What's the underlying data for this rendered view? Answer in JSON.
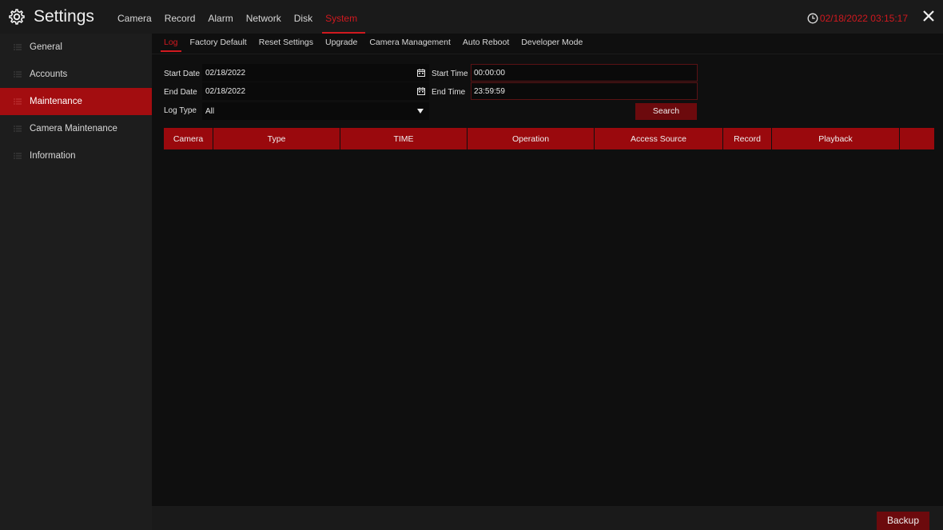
{
  "app": {
    "title": "Settings",
    "icon": "gear-icon"
  },
  "topnav": {
    "items": [
      {
        "label": "Camera",
        "active": false
      },
      {
        "label": "Record",
        "active": false
      },
      {
        "label": "Alarm",
        "active": false
      },
      {
        "label": "Network",
        "active": false
      },
      {
        "label": "Disk",
        "active": false
      },
      {
        "label": "System",
        "active": true
      }
    ]
  },
  "clock": {
    "datetime": "02/18/2022 03:15:17",
    "icon": "clock-icon"
  },
  "close": {
    "icon": "close-icon"
  },
  "sidebar": {
    "items": [
      {
        "label": "General",
        "active": false
      },
      {
        "label": "Accounts",
        "active": false
      },
      {
        "label": "Maintenance",
        "active": true
      },
      {
        "label": "Camera Maintenance",
        "active": false
      },
      {
        "label": "Information",
        "active": false
      }
    ]
  },
  "subnav": {
    "tabs": [
      {
        "label": "Log",
        "active": true
      },
      {
        "label": "Factory Default",
        "active": false
      },
      {
        "label": "Reset Settings",
        "active": false
      },
      {
        "label": "Upgrade",
        "active": false
      },
      {
        "label": "Camera Management",
        "active": false
      },
      {
        "label": "Auto Reboot",
        "active": false
      },
      {
        "label": "Developer Mode",
        "active": false
      }
    ]
  },
  "form": {
    "start_date_label": "Start Date",
    "start_date_value": "02/18/2022",
    "start_time_label": "Start Time",
    "start_time_value": "00:00:00",
    "end_date_label": "End Date",
    "end_date_value": "02/18/2022",
    "end_time_label": "End Time",
    "end_time_value": "23:59:59",
    "log_type_label": "Log Type",
    "log_type_value": "All",
    "search_label": "Search"
  },
  "table": {
    "columns": [
      "Camera",
      "Type",
      "TIME",
      "Operation",
      "Access Source",
      "Record",
      "Playback",
      ""
    ]
  },
  "footer": {
    "backup_label": "Backup"
  },
  "colors": {
    "accent": "#d0191f",
    "active_bg": "#a30d10",
    "button_bg": "#6c0a0d",
    "header_bg": "#9a090d"
  }
}
